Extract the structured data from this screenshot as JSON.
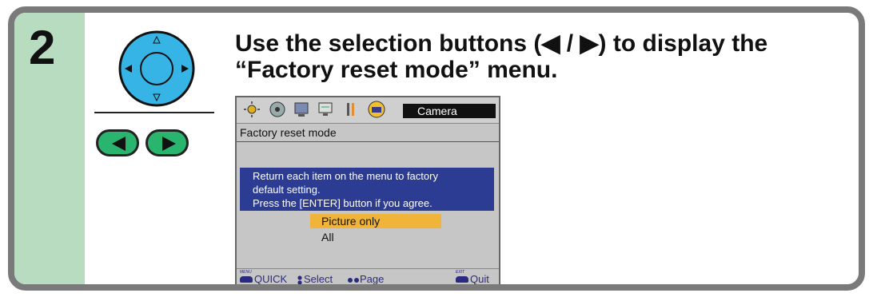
{
  "step": {
    "number": "2"
  },
  "instruction": {
    "line1": "Use the selection buttons (◀ / ▶) to display the",
    "line2": "“Factory reset mode” menu."
  },
  "screen": {
    "category_label": "Camera",
    "menu_title": "Factory reset mode",
    "message": [
      "Return each item on the menu to factory",
      "default setting.",
      "Press the [ENTER] button if you agree."
    ],
    "options": [
      "Picture only",
      "All"
    ],
    "selected_option": "Picture only",
    "footer": {
      "menu_key": "MENU",
      "quick": "QUICK",
      "select": "Select",
      "page": "Page",
      "exit_key": "EXIT",
      "quit": "Quit"
    }
  },
  "colors": {
    "green_panel": "#b8dcc0",
    "dpad_blue": "#36b4e6",
    "button_green": "#2ab56f",
    "message_blue": "#2c3c92",
    "highlight_orange": "#f0b43a"
  },
  "icons": [
    "dpad-icon",
    "left-arrow-button-icon",
    "right-arrow-button-icon",
    "brightness-icon",
    "disc-icon",
    "monitor-icon",
    "screen-icon",
    "tools-icon",
    "camera-settings-icon"
  ]
}
